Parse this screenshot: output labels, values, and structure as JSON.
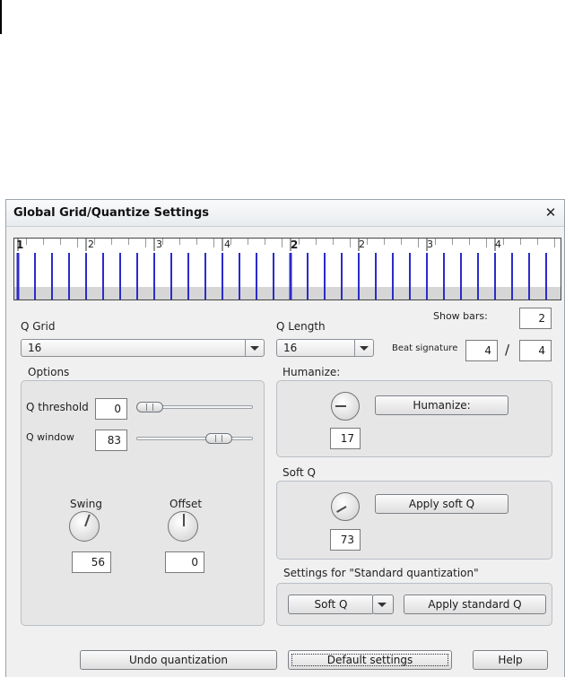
{
  "dialog": {
    "title": "Global Grid/Quantize Settings",
    "close_glyph": "✕",
    "ruler": {
      "bars": [
        "1",
        "2"
      ],
      "beats": [
        "2",
        "3",
        "4",
        "2",
        "3",
        "4"
      ],
      "accent_color": "#2b2bcc"
    },
    "q_grid": {
      "label": "Q Grid",
      "value": "16"
    },
    "q_length": {
      "label": "Q Length",
      "value": "16"
    },
    "show_bars": {
      "label": "Show bars:",
      "value": "2"
    },
    "beat_signature": {
      "label": "Beat signature",
      "numerator": "4",
      "separator": "/",
      "denominator": "4"
    },
    "options": {
      "title": "Options",
      "q_threshold": {
        "label": "Q threshold",
        "value": "0"
      },
      "q_window": {
        "label": "Q window",
        "value": "83"
      },
      "swing": {
        "label": "Swing",
        "value": "56"
      },
      "offset": {
        "label": "Offset",
        "value": "0"
      }
    },
    "humanize": {
      "title": "Humanize:",
      "button": "Humanize:",
      "value": "17"
    },
    "soft_q": {
      "title": "Soft Q",
      "button": "Apply soft Q",
      "value": "73"
    },
    "standard": {
      "title": "Settings for \"Standard quantization\"",
      "mode": "Soft Q",
      "button": "Apply standard Q"
    },
    "footer": {
      "undo": "Undo quantization",
      "default": "Default settings",
      "help": "Help"
    }
  }
}
